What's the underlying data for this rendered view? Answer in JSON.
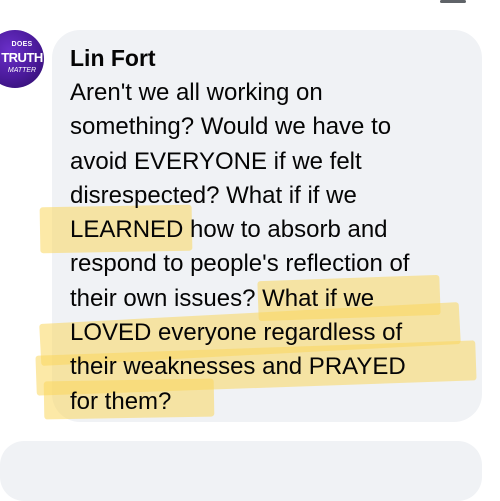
{
  "comment": {
    "avatar": {
      "line1": "DOES",
      "line2": "TRUTH",
      "line3": "MATTER"
    },
    "author": "Lin Fort",
    "lines": [
      "Aren't we all working on",
      "something? Would we have to",
      "avoid EVERYONE if we felt",
      "disrespected? What if if we",
      "LEARNED how to absorb and",
      "respond to people's reflection of",
      "their own issues? What if we",
      "LOVED everyone regardless of",
      "their weaknesses and PRAYED",
      "for them?"
    ]
  },
  "colors": {
    "bubble": "#f0f2f5",
    "highlight": "#fad75f",
    "avatar": "#4a1a9a",
    "text": "#050505"
  },
  "icons": [
    "menu-bar-icon"
  ]
}
